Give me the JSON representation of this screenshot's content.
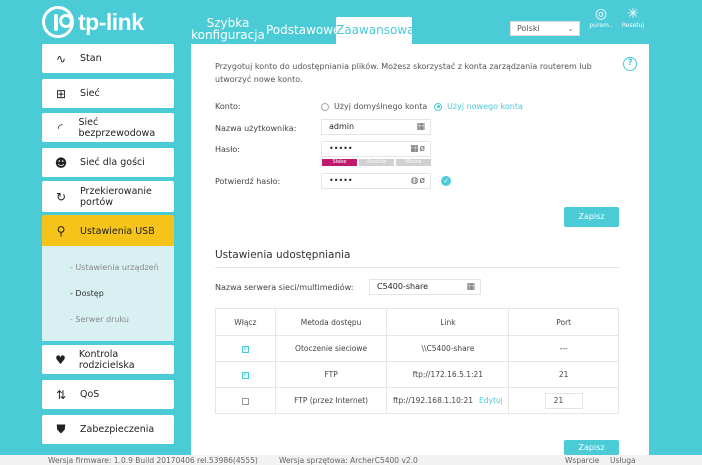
{
  "header": {
    "logo_text": "tp-link",
    "tabs": [
      {
        "label": "Szybka konfiguracja"
      },
      {
        "label": "Podstawowe"
      },
      {
        "label": "Zaawansowane"
      }
    ],
    "language": "Polski",
    "account_label": "purem..",
    "reset_label": "Resetuj"
  },
  "sidebar": {
    "items": [
      {
        "label": "Stan",
        "icon": "pulse-icon"
      },
      {
        "label": "Sieć",
        "icon": "network-icon"
      },
      {
        "label": "Sieć bezprzewodowa",
        "icon": "wireless-icon"
      },
      {
        "label": "Sieć dla gości",
        "icon": "guest-icon"
      },
      {
        "label": "Przekierowanie portów",
        "icon": "forwarding-icon"
      },
      {
        "label": "Ustawienia USB",
        "icon": "usb-icon"
      },
      {
        "label": "Kontrola rodzicielska",
        "icon": "heart-icon"
      },
      {
        "label": "QoS",
        "icon": "qos-icon"
      },
      {
        "label": "Zabezpieczenia",
        "icon": "shield-icon"
      }
    ],
    "submenu": [
      {
        "label": "- Ustawienia urządzeń"
      },
      {
        "label": "- Dostęp"
      },
      {
        "label": "- Serwer druku"
      }
    ]
  },
  "account_form": {
    "intro": "Przygotuj konto do udostępniania plików. Możesz skorzystać z konta zarządzania routerem lub utworzyć nowe konto.",
    "konto_label": "Konto:",
    "option_default": "Użyj domyślnego konta",
    "option_new": "Użyj nowego konta",
    "username_label": "Nazwa użytkownika:",
    "username_value": "admin",
    "password_label": "Hasło:",
    "password_value": "•••••",
    "strength": [
      "Słabe",
      "Średnia",
      "Mocne"
    ],
    "confirm_label": "Potwierdź hasło:",
    "confirm_value": "•••••",
    "save_label": "Zapisz"
  },
  "sharing": {
    "title": "Ustawienia udostępniania",
    "server_label": "Nazwa serwera sieci/multimediów:",
    "server_value": "C5400-share",
    "columns": [
      "Włącz",
      "Metoda dostępu",
      "Link",
      "Port"
    ],
    "rows": [
      {
        "enabled": true,
        "method": "Otoczenie sieciowe",
        "link": "\\\\C5400-share",
        "port": "---"
      },
      {
        "enabled": true,
        "method": "FTP",
        "link": "ftp://172.16.5.1:21",
        "port": "21"
      },
      {
        "enabled": false,
        "method": "FTP (przez Internet)",
        "link": "ftp://192.168.1.10:21",
        "edit": "Edytuj",
        "port": "21"
      }
    ],
    "save_label": "Zapisz"
  },
  "footer": {
    "firmware": "Wersja firmware: 1.0.9 Build 20170406 rel.53986(4555)",
    "hardware": "Wersja sprzętowa: ArcherC5400 v2.0",
    "support": "Wsparcie",
    "app": "Usługa"
  }
}
